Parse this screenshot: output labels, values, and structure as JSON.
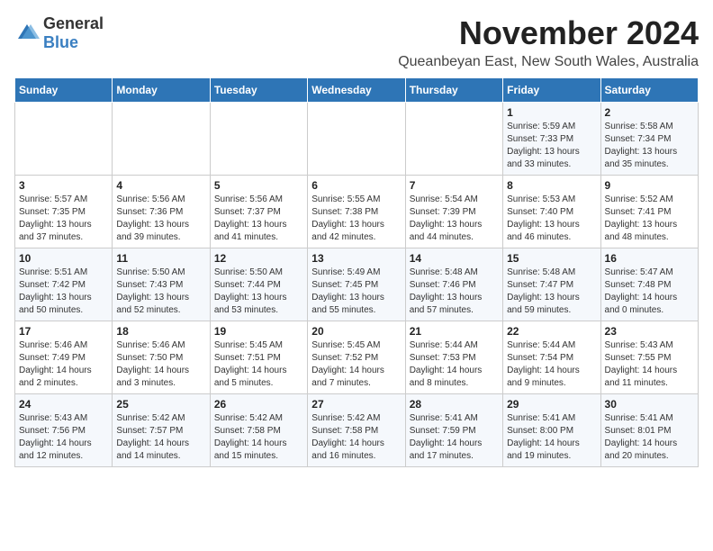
{
  "header": {
    "logo_general": "General",
    "logo_blue": "Blue",
    "month": "November 2024",
    "location": "Queanbeyan East, New South Wales, Australia"
  },
  "weekdays": [
    "Sunday",
    "Monday",
    "Tuesday",
    "Wednesday",
    "Thursday",
    "Friday",
    "Saturday"
  ],
  "weeks": [
    [
      {
        "day": "",
        "info": ""
      },
      {
        "day": "",
        "info": ""
      },
      {
        "day": "",
        "info": ""
      },
      {
        "day": "",
        "info": ""
      },
      {
        "day": "",
        "info": ""
      },
      {
        "day": "1",
        "info": "Sunrise: 5:59 AM\nSunset: 7:33 PM\nDaylight: 13 hours and 33 minutes."
      },
      {
        "day": "2",
        "info": "Sunrise: 5:58 AM\nSunset: 7:34 PM\nDaylight: 13 hours and 35 minutes."
      }
    ],
    [
      {
        "day": "3",
        "info": "Sunrise: 5:57 AM\nSunset: 7:35 PM\nDaylight: 13 hours and 37 minutes."
      },
      {
        "day": "4",
        "info": "Sunrise: 5:56 AM\nSunset: 7:36 PM\nDaylight: 13 hours and 39 minutes."
      },
      {
        "day": "5",
        "info": "Sunrise: 5:56 AM\nSunset: 7:37 PM\nDaylight: 13 hours and 41 minutes."
      },
      {
        "day": "6",
        "info": "Sunrise: 5:55 AM\nSunset: 7:38 PM\nDaylight: 13 hours and 42 minutes."
      },
      {
        "day": "7",
        "info": "Sunrise: 5:54 AM\nSunset: 7:39 PM\nDaylight: 13 hours and 44 minutes."
      },
      {
        "day": "8",
        "info": "Sunrise: 5:53 AM\nSunset: 7:40 PM\nDaylight: 13 hours and 46 minutes."
      },
      {
        "day": "9",
        "info": "Sunrise: 5:52 AM\nSunset: 7:41 PM\nDaylight: 13 hours and 48 minutes."
      }
    ],
    [
      {
        "day": "10",
        "info": "Sunrise: 5:51 AM\nSunset: 7:42 PM\nDaylight: 13 hours and 50 minutes."
      },
      {
        "day": "11",
        "info": "Sunrise: 5:50 AM\nSunset: 7:43 PM\nDaylight: 13 hours and 52 minutes."
      },
      {
        "day": "12",
        "info": "Sunrise: 5:50 AM\nSunset: 7:44 PM\nDaylight: 13 hours and 53 minutes."
      },
      {
        "day": "13",
        "info": "Sunrise: 5:49 AM\nSunset: 7:45 PM\nDaylight: 13 hours and 55 minutes."
      },
      {
        "day": "14",
        "info": "Sunrise: 5:48 AM\nSunset: 7:46 PM\nDaylight: 13 hours and 57 minutes."
      },
      {
        "day": "15",
        "info": "Sunrise: 5:48 AM\nSunset: 7:47 PM\nDaylight: 13 hours and 59 minutes."
      },
      {
        "day": "16",
        "info": "Sunrise: 5:47 AM\nSunset: 7:48 PM\nDaylight: 14 hours and 0 minutes."
      }
    ],
    [
      {
        "day": "17",
        "info": "Sunrise: 5:46 AM\nSunset: 7:49 PM\nDaylight: 14 hours and 2 minutes."
      },
      {
        "day": "18",
        "info": "Sunrise: 5:46 AM\nSunset: 7:50 PM\nDaylight: 14 hours and 3 minutes."
      },
      {
        "day": "19",
        "info": "Sunrise: 5:45 AM\nSunset: 7:51 PM\nDaylight: 14 hours and 5 minutes."
      },
      {
        "day": "20",
        "info": "Sunrise: 5:45 AM\nSunset: 7:52 PM\nDaylight: 14 hours and 7 minutes."
      },
      {
        "day": "21",
        "info": "Sunrise: 5:44 AM\nSunset: 7:53 PM\nDaylight: 14 hours and 8 minutes."
      },
      {
        "day": "22",
        "info": "Sunrise: 5:44 AM\nSunset: 7:54 PM\nDaylight: 14 hours and 9 minutes."
      },
      {
        "day": "23",
        "info": "Sunrise: 5:43 AM\nSunset: 7:55 PM\nDaylight: 14 hours and 11 minutes."
      }
    ],
    [
      {
        "day": "24",
        "info": "Sunrise: 5:43 AM\nSunset: 7:56 PM\nDaylight: 14 hours and 12 minutes."
      },
      {
        "day": "25",
        "info": "Sunrise: 5:42 AM\nSunset: 7:57 PM\nDaylight: 14 hours and 14 minutes."
      },
      {
        "day": "26",
        "info": "Sunrise: 5:42 AM\nSunset: 7:58 PM\nDaylight: 14 hours and 15 minutes."
      },
      {
        "day": "27",
        "info": "Sunrise: 5:42 AM\nSunset: 7:58 PM\nDaylight: 14 hours and 16 minutes."
      },
      {
        "day": "28",
        "info": "Sunrise: 5:41 AM\nSunset: 7:59 PM\nDaylight: 14 hours and 17 minutes."
      },
      {
        "day": "29",
        "info": "Sunrise: 5:41 AM\nSunset: 8:00 PM\nDaylight: 14 hours and 19 minutes."
      },
      {
        "day": "30",
        "info": "Sunrise: 5:41 AM\nSunset: 8:01 PM\nDaylight: 14 hours and 20 minutes."
      }
    ]
  ]
}
